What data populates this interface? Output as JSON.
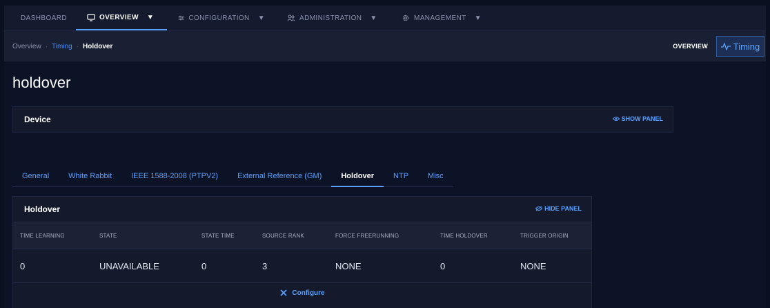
{
  "topnav": {
    "items": [
      {
        "label": "DASHBOARD",
        "icon": "dashboard-icon"
      },
      {
        "label": "OVERVIEW",
        "icon": "monitor-icon",
        "active": true
      },
      {
        "label": "CONFIGURATION",
        "icon": "sliders-icon"
      },
      {
        "label": "ADMINISTRATION",
        "icon": "users-icon"
      },
      {
        "label": "MANAGEMENT",
        "icon": "gear-icon"
      }
    ],
    "caret": "▼"
  },
  "breadcrumb": {
    "items": [
      "Overview",
      "Timing",
      "Holdover"
    ],
    "separator": "·",
    "right_label": "OVERVIEW",
    "timing_button": "Timing"
  },
  "page": {
    "title": "holdover"
  },
  "device_panel": {
    "title": "Device",
    "action": "SHOW PANEL"
  },
  "tabs": [
    "General",
    "White Rabbit",
    "IEEE 1588-2008 (PTPV2)",
    "External Reference (GM)",
    "Holdover",
    "NTP",
    "Misc"
  ],
  "active_tab": "Holdover",
  "holdover_panel": {
    "title": "Holdover",
    "action": "HIDE PANEL",
    "columns": [
      "TIME LEARNING",
      "STATE",
      "STATE TIME",
      "SOURCE RANK",
      "FORCE FREERUNNING",
      "TIME HOLDOVER",
      "TRIGGER ORIGIN"
    ],
    "row": [
      "0",
      "UNAVAILABLE",
      "0",
      "3",
      "NONE",
      "0",
      "NONE"
    ],
    "configure_label": "Configure"
  },
  "colors": {
    "accent": "#5aa0ff",
    "background": "#0d1326",
    "panel": "#141a2c"
  }
}
